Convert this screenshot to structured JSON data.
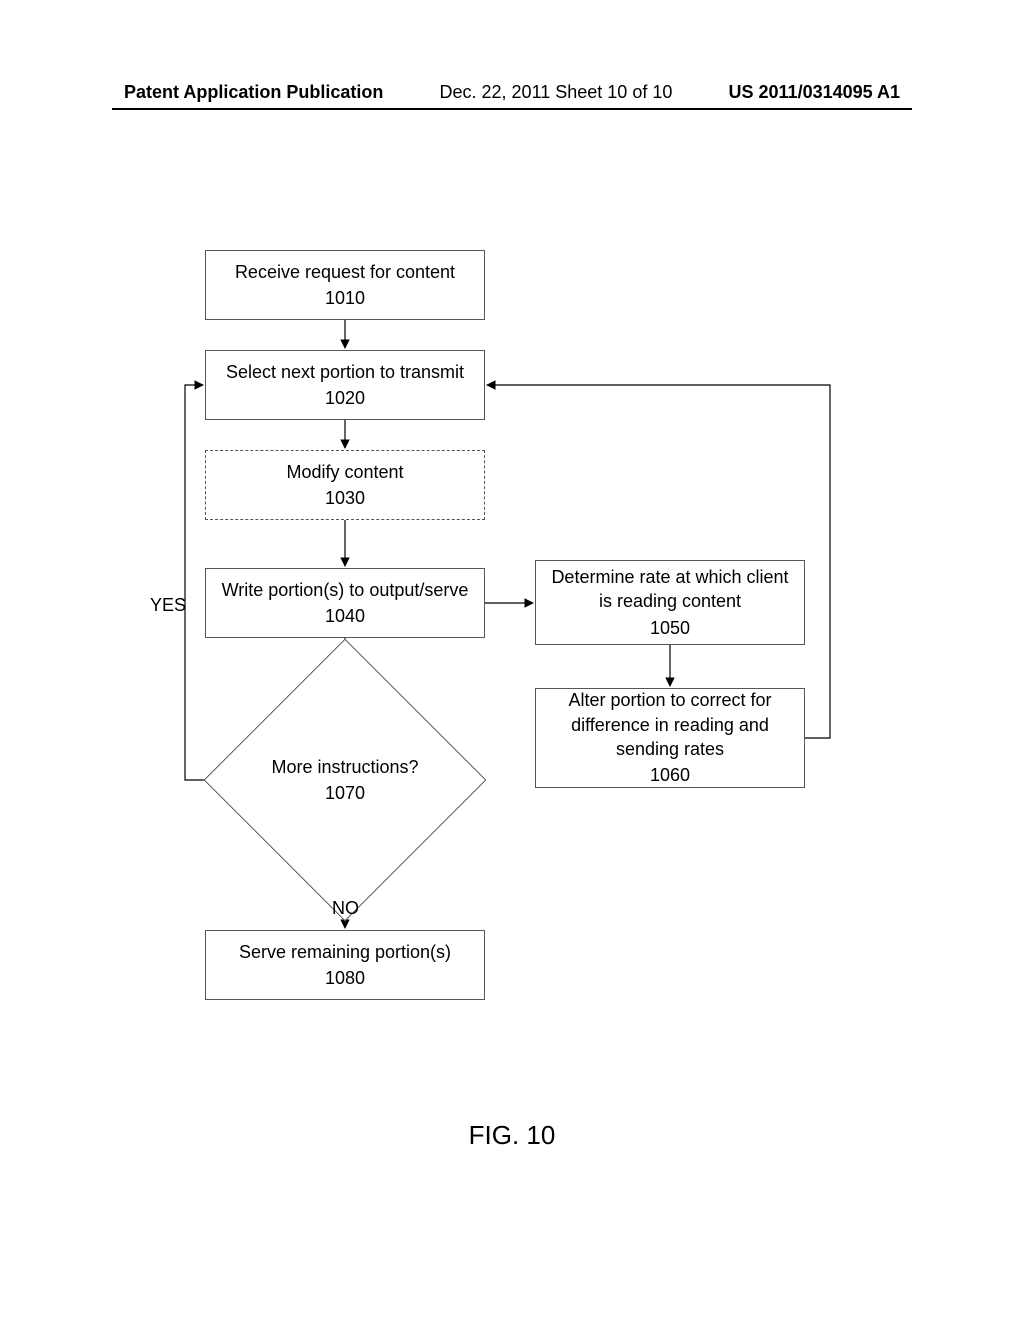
{
  "header": {
    "left": "Patent Application Publication",
    "mid": "Dec. 22, 2011  Sheet 10 of 10",
    "right": "US 2011/0314095 A1"
  },
  "nodes": {
    "n1010": {
      "text": "Receive request for content",
      "num": "1010"
    },
    "n1020": {
      "text": "Select next portion to transmit",
      "num": "1020"
    },
    "n1030": {
      "text": "Modify content",
      "num": "1030"
    },
    "n1040": {
      "text": "Write portion(s) to output/serve",
      "num": "1040"
    },
    "n1050": {
      "text": "Determine rate at which client is reading content",
      "num": "1050"
    },
    "n1060": {
      "text": "Alter portion to correct for difference in reading and sending rates",
      "num": "1060"
    },
    "n1070": {
      "text": "More instructions?",
      "num": "1070"
    },
    "n1080": {
      "text": "Serve remaining portion(s)",
      "num": "1080"
    }
  },
  "edges": {
    "yes": "YES",
    "no": "NO"
  },
  "caption": "FIG. 10"
}
